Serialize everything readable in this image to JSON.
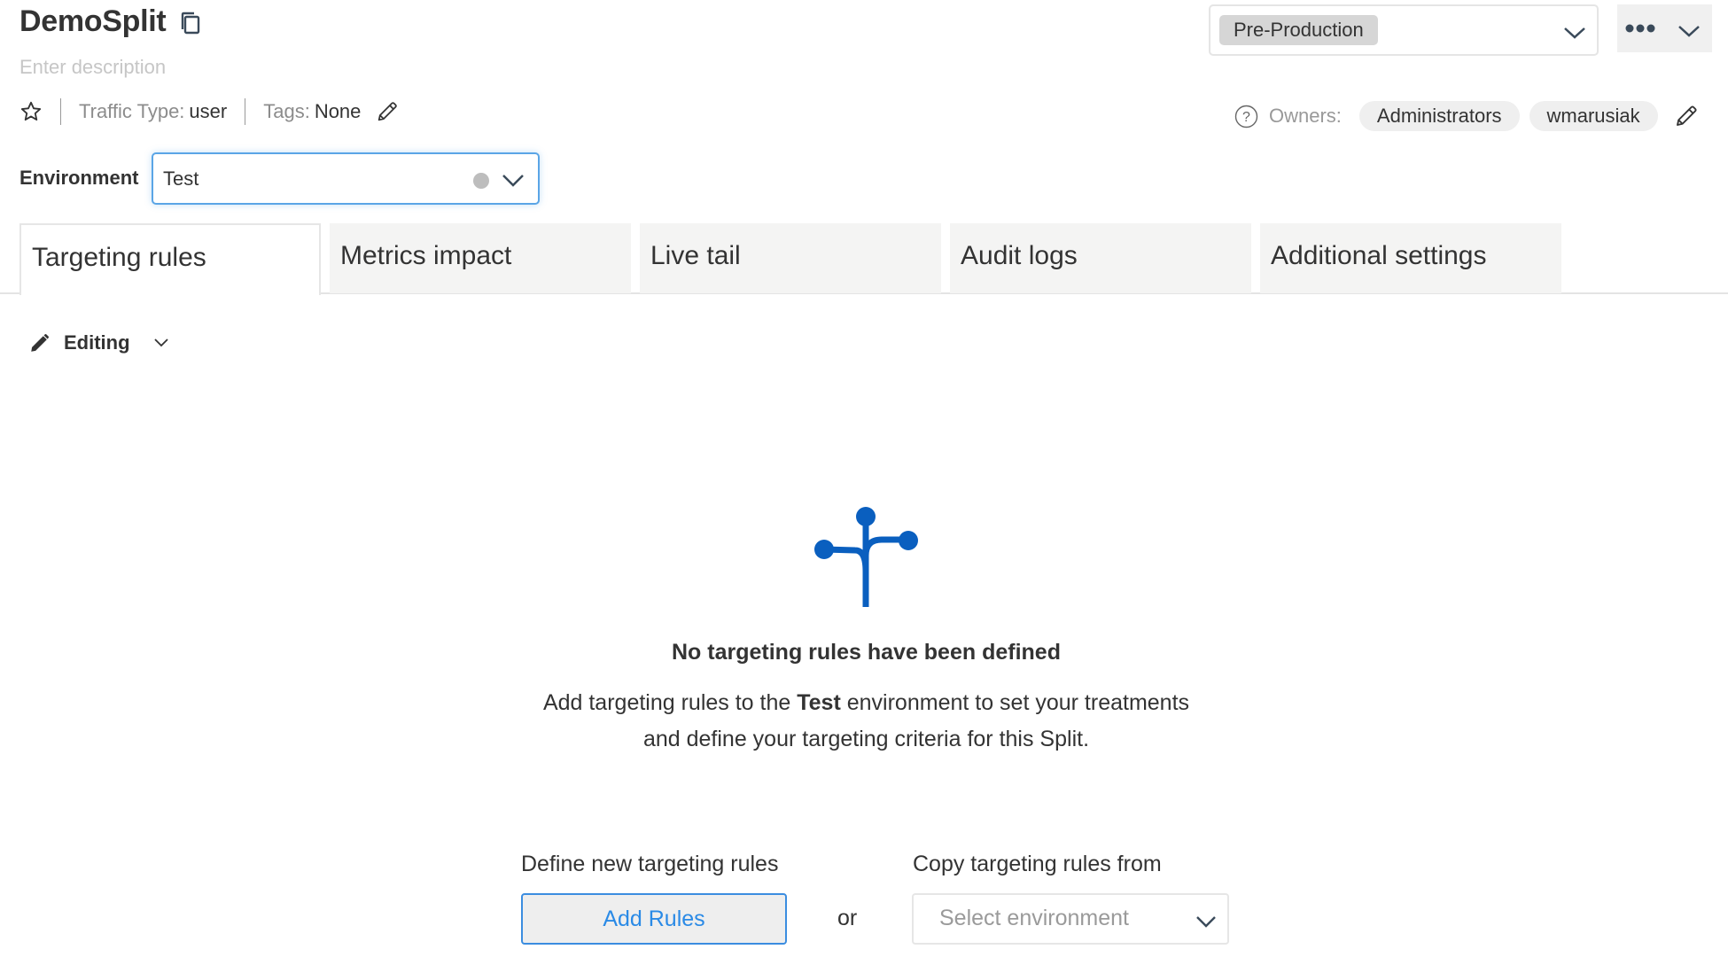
{
  "header": {
    "title": "DemoSplit",
    "description_placeholder": "Enter description",
    "traffic_type_label": "Traffic Type:",
    "traffic_type_value": "user",
    "tags_label": "Tags:",
    "tags_value": "None"
  },
  "workspace": {
    "selected": "Pre-Production"
  },
  "owners": {
    "label": "Owners:",
    "list": [
      "Administrators",
      "wmarusiak"
    ]
  },
  "environment": {
    "label": "Environment",
    "selected": "Test",
    "status_color": "#bdbdbd"
  },
  "tabs": [
    {
      "label": "Targeting rules",
      "active": true
    },
    {
      "label": "Metrics impact",
      "active": false
    },
    {
      "label": "Live tail",
      "active": false
    },
    {
      "label": "Audit logs",
      "active": false
    },
    {
      "label": "Additional settings",
      "active": false
    }
  ],
  "mode": {
    "label": "Editing"
  },
  "empty_state": {
    "icon": "split-tree-icon",
    "icon_color": "#0a5fbf",
    "title": "No targeting rules have been defined",
    "desc_part1": "Add targeting rules to the ",
    "desc_env": "Test",
    "desc_part2": " environment to set your treatments",
    "desc_line2": "and define your targeting criteria for this Split."
  },
  "actions": {
    "define_label": "Define new targeting rules",
    "add_rules_button": "Add Rules",
    "or_text": "or",
    "copy_label": "Copy targeting rules from",
    "select_env_placeholder": "Select environment"
  },
  "colors": {
    "accent": "#2a8ae6",
    "focus_border": "#5aa5e6"
  }
}
